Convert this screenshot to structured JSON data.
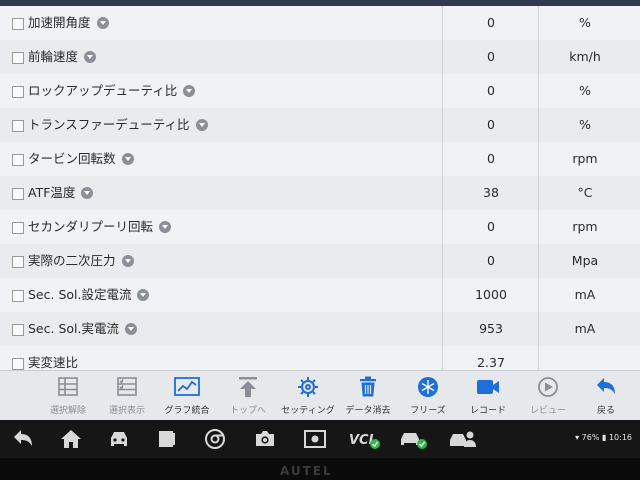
{
  "rows": [
    {
      "name": "加速開角度",
      "value": "0",
      "unit": "%"
    },
    {
      "name": "前輪速度",
      "value": "0",
      "unit": "km/h"
    },
    {
      "name": "ロックアップデューティ比",
      "value": "0",
      "unit": "%"
    },
    {
      "name": "トランスファーデューティ比",
      "value": "0",
      "unit": "%"
    },
    {
      "name": "タービン回転数",
      "value": "0",
      "unit": "rpm"
    },
    {
      "name": "ATF温度",
      "value": "38",
      "unit": "°C"
    },
    {
      "name": "セカンダリプーリ回転",
      "value": "0",
      "unit": "rpm"
    },
    {
      "name": "実際の二次圧力",
      "value": "0",
      "unit": "Mpa"
    },
    {
      "name": "Sec. Sol.設定電流",
      "value": "1000",
      "unit": "mA"
    },
    {
      "name": "Sec. Sol.実電流",
      "value": "953",
      "unit": "mA"
    },
    {
      "name": "実変速比",
      "value": "2.37",
      "unit": ""
    }
  ],
  "toolbar": {
    "deselect": "選択解除",
    "show_selected": "選択表示",
    "graph_merge": "グラフ統合",
    "to_top": "トップへ",
    "settings": "セッティング",
    "clear_data": "データ消去",
    "freeze": "フリーズ",
    "record": "レコード",
    "review": "レビュー",
    "back": "戻る"
  },
  "status": {
    "battery": "76%",
    "time": "10:16"
  },
  "nav": {
    "vci_label": "VCI"
  },
  "brand": "AUTEL",
  "colors": {
    "accent": "#1e6fd9",
    "dim": "#8a8e96",
    "vci_green": "#2db84b"
  }
}
